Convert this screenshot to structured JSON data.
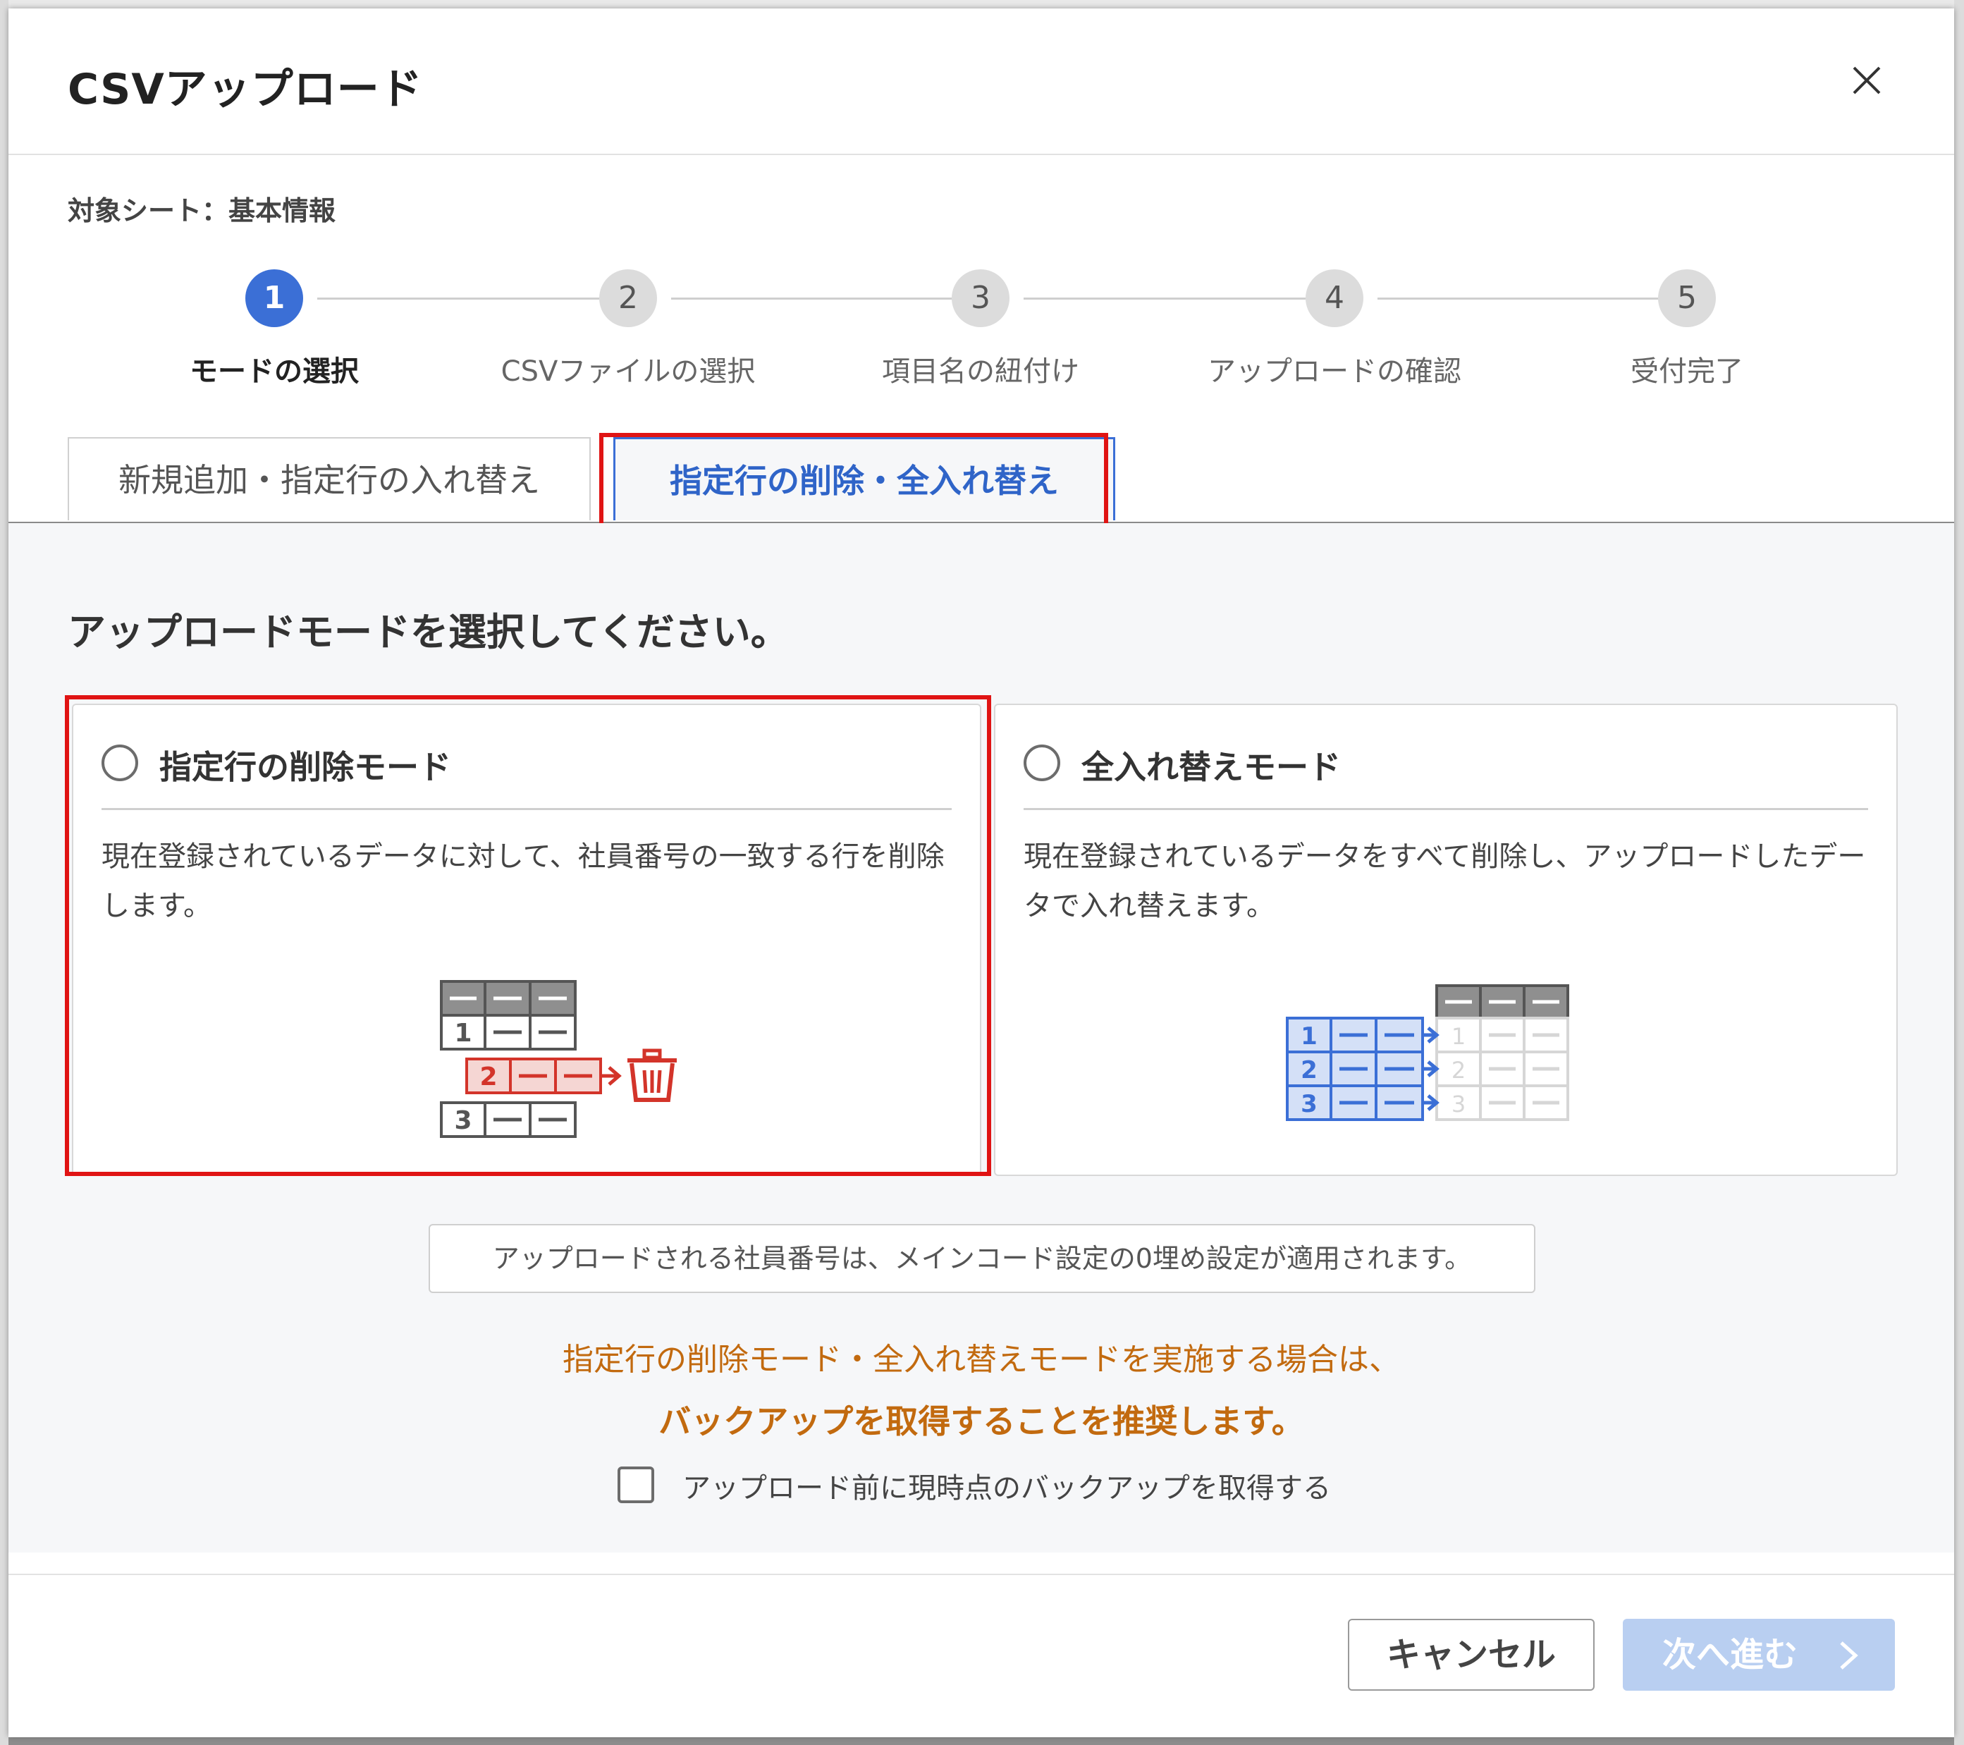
{
  "dialog": {
    "title": "CSVアップロード"
  },
  "target_sheet": "対象シート：基本情報",
  "steps": [
    {
      "number": "1",
      "label": "モードの選択",
      "active": true
    },
    {
      "number": "2",
      "label": "CSVファイルの選択",
      "active": false
    },
    {
      "number": "3",
      "label": "項目名の紐付け",
      "active": false
    },
    {
      "number": "4",
      "label": "アップロードの確認",
      "active": false
    },
    {
      "number": "5",
      "label": "受付完了",
      "active": false
    }
  ],
  "tabs": [
    {
      "label": "新規追加・指定行の入れ替え",
      "selected": false
    },
    {
      "label": "指定行の削除・全入れ替え",
      "selected": true
    }
  ],
  "prompt": "アップロードモードを選択してください。",
  "modes": [
    {
      "title": "指定行の削除モード",
      "desc": "現在登録されているデータに対して、社員番号の一致する行を削除します。",
      "icon": "delete-row-illustration",
      "rows": [
        "1",
        "2",
        "3"
      ]
    },
    {
      "title": "全入れ替えモード",
      "desc": "現在登録されているデータをすべて削除し、アップロードしたデータで入れ替えます。",
      "icon": "replace-all-illustration",
      "rows": [
        "1",
        "2",
        "3"
      ]
    }
  ],
  "note": "アップロードされる社員番号は、メインコード設定の0埋め設定が適用されます。",
  "warning": {
    "line1": "指定行の削除モード・全入れ替えモードを実施する場合は、",
    "line2": "バックアップを取得することを推奨します。"
  },
  "backup_checkbox": {
    "label": "アップロード前に現時点のバックアップを取得する",
    "checked": false
  },
  "buttons": {
    "cancel": "キャンセル",
    "next": "次へ進む"
  },
  "colors": {
    "accent": "#3b6fd6",
    "highlight": "#e01414",
    "warning": "#c26a0f",
    "delete_red": "#d3342a",
    "next_disabled": "#b9cff1"
  }
}
